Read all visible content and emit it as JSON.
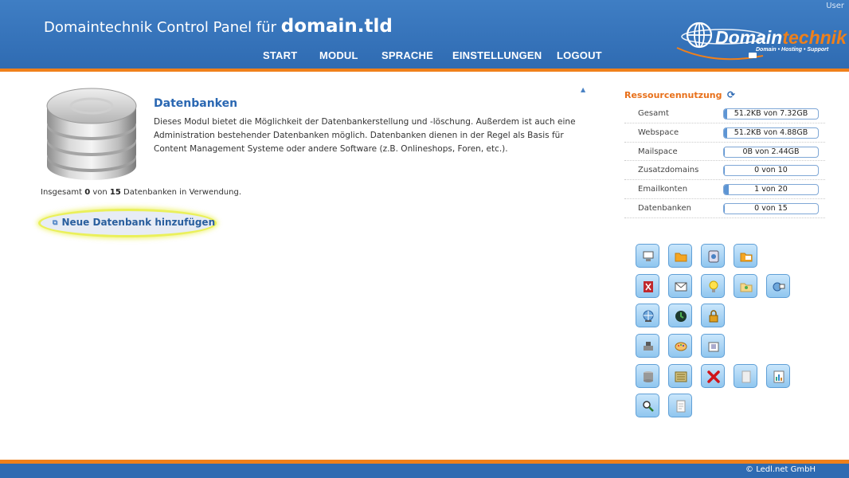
{
  "header": {
    "user": "User",
    "title_prefix": "Domaintechnik Control Panel für",
    "title_domain": "domain.tld",
    "nav": [
      "START",
      "MODUL",
      "SPRACHE",
      "EINSTELLUNGEN",
      "LOGOUT"
    ],
    "logo_main": "Domain",
    "logo_accent": "technik",
    "logo_sub": "Domain • Hosting • Support"
  },
  "module": {
    "title": "Datenbanken",
    "description": "Dieses Modul bietet die Möglichkeit der Datenbankerstellung und -löschung. Außerdem ist auch eine Administration bestehender Datenbanken möglich. Datenbanken dienen in der Regel als Basis für Content Management Systeme oder andere Software (z.B. Onlineshops, Foren, etc.).",
    "usage_prefix": "Insgesamt",
    "usage_used": "0",
    "usage_mid": "von",
    "usage_total": "15",
    "usage_suffix": "Datenbanken in Verwendung.",
    "add_button": "Neue Datenbank hinzufügen"
  },
  "resources": {
    "title": "Ressourcennutzung",
    "refresh_icon": "refresh-icon",
    "rows": [
      {
        "label": "Gesamt",
        "value": "51.2KB von 7.32GB",
        "fraction": 0.007
      },
      {
        "label": "Webspace",
        "value": "51.2KB von 4.88GB",
        "fraction": 0.01
      },
      {
        "label": "Mailspace",
        "value": "0B von 2.44GB",
        "fraction": 0.0
      },
      {
        "label": "Zusatzdomains",
        "value": "0 von 10",
        "fraction": 0.0
      },
      {
        "label": "Emailkonten",
        "value": "1 von 20",
        "fraction": 0.05
      },
      {
        "label": "Datenbanken",
        "value": "0 von 15",
        "fraction": 0.0
      }
    ]
  },
  "quick_icons": [
    [
      "monitor-icon",
      "folder-icon",
      "cd-drive-icon",
      "mail-folder-icon"
    ],
    [
      "firewall-icon",
      "mail-icon",
      "lightbulb-icon",
      "image-folder-icon",
      "globe-link-icon"
    ],
    [
      "network-globe-icon",
      "clock-globe-icon",
      "lock-icon"
    ],
    [
      "stamp-icon",
      "palette-icon",
      "package-icon"
    ],
    [
      "database-icon",
      "archive-icon",
      "delete-icon",
      "document-icon",
      "statistics-icon"
    ],
    [
      "search-icon",
      "page-icon"
    ]
  ],
  "footer": {
    "copyright": "© Ledl.net GmbH"
  },
  "colors": {
    "header_blue": "#2f6bb2",
    "accent_orange": "#f0801a",
    "title_blue": "#2a67b2",
    "highlight_yellow": "#eaf05a"
  }
}
